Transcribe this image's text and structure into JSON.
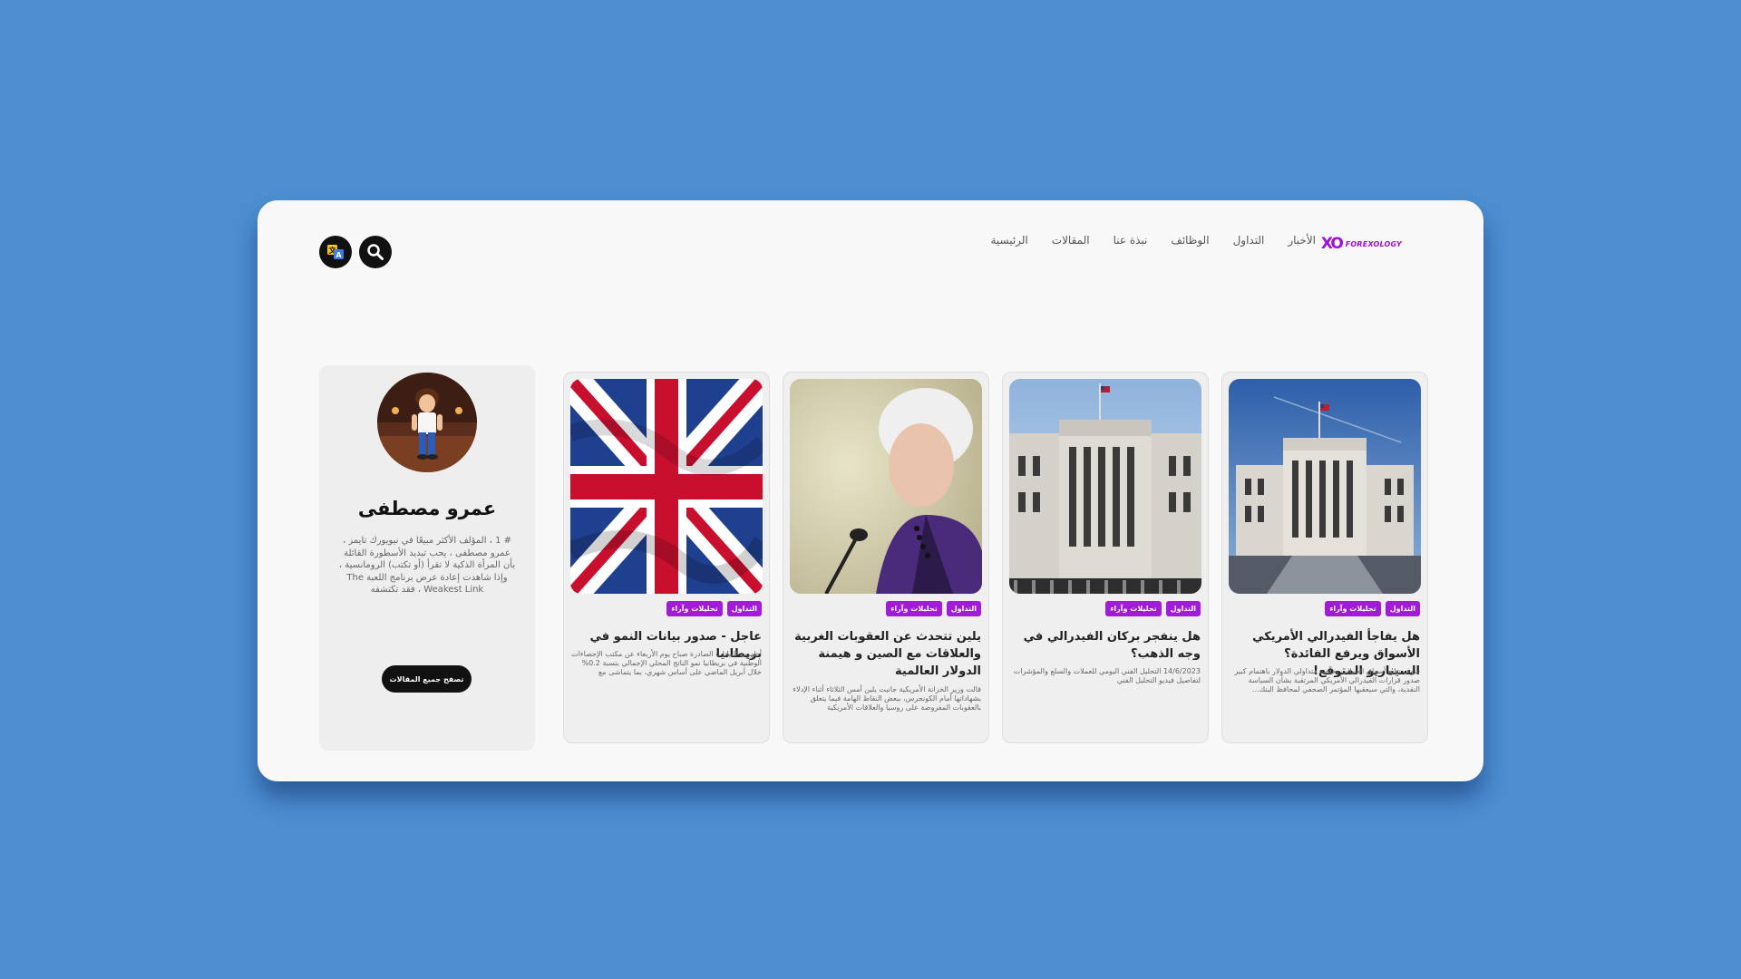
{
  "brand": {
    "name": "FOREXOLOGY",
    "mark": "XO",
    "color": "#9b12d6"
  },
  "nav": {
    "items": [
      {
        "label": "الرئيسية"
      },
      {
        "label": "المقالات"
      },
      {
        "label": "نبذة عنا"
      },
      {
        "label": "الوظائف"
      },
      {
        "label": "التداول"
      },
      {
        "label": "الأخبار"
      }
    ],
    "search_icon": "search-icon",
    "language_icon": "translate-icon"
  },
  "cards": [
    {
      "tags": [
        "التداول",
        "تحليلات وآراء"
      ],
      "title": "هل يفاجأ الفيدرالي الأمريكي الأسواق ويرفع الفائدة؟ السيناريو المتوقع!",
      "description": "سوف تتابع أسواق العملات بخاصة متداولي الدولار باهتمام كبير صدور قرارات الفيدرالي الأمريكي المرتقبة بشأن السياسة النقدية، والتي سيعقبها المؤتمر الصحفي لمحافظ البنك...",
      "image": "federal-reserve-building-photo"
    },
    {
      "tags": [
        "التداول",
        "تحليلات وآراء"
      ],
      "title": "هل ينفجر بركان الفيدرالي في وجه الذهب؟",
      "description": "14/6/2023 التحليل الفني اليومي للعملات والسلع والمؤشرات لتفاصيل فيديو التحليل الفني",
      "image": "federal-reserve-building-photo"
    },
    {
      "tags": [
        "التداول",
        "تحليلات وآراء"
      ],
      "title": "يلين تتحدث عن العقوبات الغربية والعلاقات مع الصين و هيمنة الدولار العالمية",
      "description": "قالت وزير الخزانة الأمريكية جانيت يلين أمس الثلاثاء أثناء الإدلاء بشهاداتها أمام الكونجرس، ببعض النقاط الهامة فيما يتعلق بالعقوبات المفروضة على روسيا والعلاقات الأمريكية",
      "image": "janet-yellen-photo"
    },
    {
      "tags": [
        "التداول",
        "تحليلات وآراء"
      ],
      "title": "عاجل - صدور بيانات النمو في بريطانيا",
      "description": "أظهرت البيانات الصادرة صباح يوم الأربعاء عن مكتب الإحصاءات الوطنية في بريطانيا نمو الناتج المحلي الإجمالي بنسبة 0.2% خلال أبريل الماضي على أساس شهري، بما يتماشى مع",
      "image": "union-jack-flag-photo"
    }
  ],
  "author": {
    "name": "عمرو مصطفى",
    "bio": "# 1 ، المؤلف الأكثر مبيعًا في نيويورك تايمز ، عمرو مصطفى ، يحب تبديد الأسطورة القائلة بأن المرأة الذكية لا تقرأ (أو تكتب) الرومانسية ، وإذا شاهدت إعادة عرض برنامج اللعبة The Weakest Link ، فقد تكتشفه",
    "button_label": "تصفح جميع المقالات",
    "avatar": "cartoon-avatar"
  },
  "colors": {
    "page_background": "#4d8fd1",
    "tag": "#a21bd9",
    "button": "#111111"
  }
}
